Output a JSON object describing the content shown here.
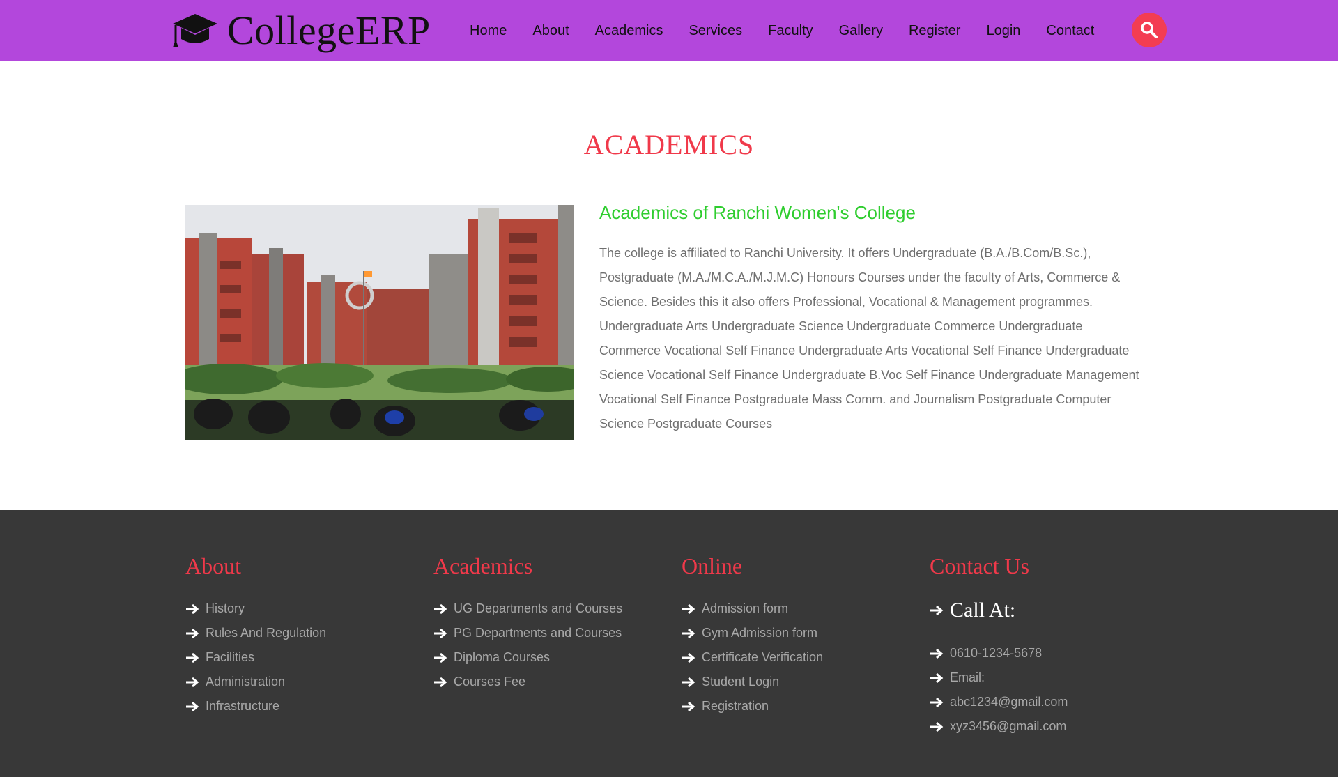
{
  "header": {
    "brand": "CollegeERP",
    "nav": [
      "Home",
      "About",
      "Academics",
      "Services",
      "Faculty",
      "Gallery",
      "Register",
      "Login",
      "Contact"
    ]
  },
  "colors": {
    "header_bg": "#b347dc",
    "accent": "#f0394a",
    "heading_green": "#2fcd2f",
    "footer_bg": "#383838"
  },
  "main": {
    "section_title": "ACADEMICS",
    "heading": "Academics of Ranchi Women's College",
    "body": "The college is affiliated to Ranchi University. It offers Undergraduate (B.A./B.Com/B.Sc.), Postgraduate (M.A./M.C.A./M.J.M.C) Honours Courses under the faculty of Arts, Commerce & Science. Besides this it also offers Professional, Vocational & Management programmes. Undergraduate Arts Undergraduate Science Undergraduate Commerce Undergraduate Commerce Vocational Self Finance Undergraduate Arts Vocational Self Finance Undergraduate Science Vocational Self Finance Undergraduate B.Voc Self Finance Undergraduate Management Vocational Self Finance Postgraduate Mass Comm. and Journalism Postgraduate Computer Science Postgraduate Courses"
  },
  "footer": {
    "about": {
      "title": "About",
      "links": [
        "History",
        "Rules And Regulation",
        "Facilities",
        "Administration",
        "Infrastructure"
      ]
    },
    "academics": {
      "title": "Academics",
      "links": [
        "UG Departments and Courses",
        "PG Departments and Courses",
        "Diploma Courses",
        "Courses Fee"
      ]
    },
    "online": {
      "title": "Online",
      "links": [
        "Admission form",
        "Gym Admission form",
        "Certificate Verification",
        "Student Login",
        "Registration"
      ]
    },
    "contact": {
      "title": "Contact Us",
      "call_at": "Call At:",
      "items": [
        "0610-1234-5678",
        "Email:",
        "abc1234@gmail.com",
        "xyz3456@gmail.com"
      ]
    }
  },
  "icons": {
    "brand": "graduation-cap-icon",
    "search": "search-icon",
    "list_bullet": "arrow-right-icon"
  }
}
